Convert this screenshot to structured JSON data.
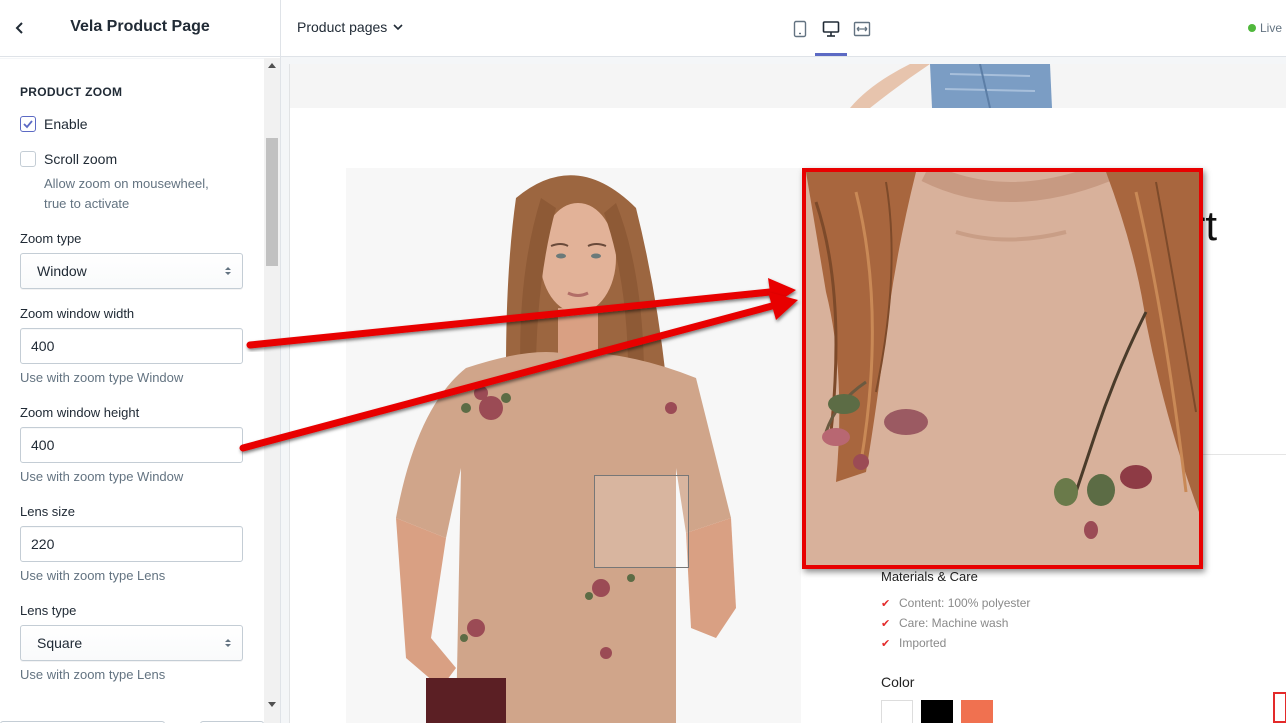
{
  "sidebar": {
    "title": "Vela Product Page",
    "section_title": "PRODUCT ZOOM",
    "enable": {
      "label": "Enable",
      "checked": true
    },
    "scroll_zoom": {
      "label": "Scroll zoom",
      "checked": false,
      "help_line1": "Allow zoom on mousewheel,",
      "help_line2": "true to activate"
    },
    "zoom_type": {
      "label": "Zoom type",
      "value": "Window"
    },
    "zoom_window_width": {
      "label": "Zoom window width",
      "value": "400",
      "help": "Use with zoom type Window"
    },
    "zoom_window_height": {
      "label": "Zoom window height",
      "value": "400",
      "help": "Use with zoom type Window"
    },
    "lens_size": {
      "label": "Lens size",
      "value": "220",
      "help": "Use with zoom type Lens"
    },
    "lens_type": {
      "label": "Lens type",
      "value": "Square",
      "help": "Use with zoom type Lens"
    }
  },
  "topbar": {
    "page_selector": "Product pages",
    "live_label": "Live",
    "devices": [
      "mobile-icon",
      "desktop-icon",
      "fullscreen-icon"
    ],
    "active_device": "desktop"
  },
  "preview": {
    "title_fragment": "irt",
    "materials_title": "Materials & Care",
    "materials": [
      "Content: 100% polyester",
      "Care: Machine wash",
      "Imported"
    ],
    "color_label": "Color",
    "swatches": [
      "#ffffff",
      "#000000",
      "#f07150"
    ]
  },
  "colors": {
    "accent": "#5c6ac4",
    "annotation_red": "#e80000",
    "live_green": "#50b83c",
    "check_red": "#e32a2a"
  }
}
